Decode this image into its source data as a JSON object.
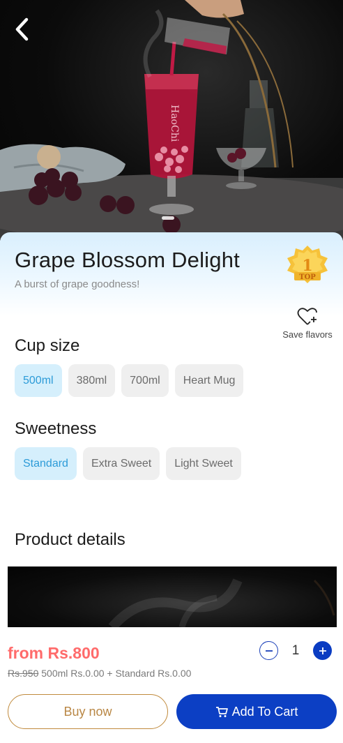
{
  "product": {
    "title": "Grape Blossom Delight",
    "subtitle": "A burst of grape goodness!",
    "badge_rank": "1",
    "badge_text": "TOP",
    "glass_brand": "HaoChi"
  },
  "save": {
    "label": "Save flavors"
  },
  "cup_size": {
    "heading": "Cup size",
    "options": [
      "500ml",
      "380ml",
      "700ml",
      "Heart Mug"
    ],
    "selected": "500ml"
  },
  "sweetness": {
    "heading": "Sweetness",
    "options": [
      "Standard",
      "Extra Sweet",
      "Light Sweet"
    ],
    "selected": "Standard"
  },
  "details": {
    "heading": "Product details"
  },
  "pricing": {
    "from_label": "from Rs.",
    "price": "800",
    "old_price": "Rs.950",
    "selection_summary": "500ml Rs.0.00 + Standard Rs.0.00"
  },
  "quantity": {
    "value": "1",
    "minus": "−",
    "plus": "+"
  },
  "actions": {
    "buy_now": "Buy now",
    "add_to_cart": "Add To Cart"
  },
  "colors": {
    "accent": "#0c3fc4",
    "price": "#ff6b6b",
    "chip_selected_bg": "#d5effc",
    "chip_selected_text": "#2c9bd8",
    "buy_border": "#c08a3c"
  }
}
